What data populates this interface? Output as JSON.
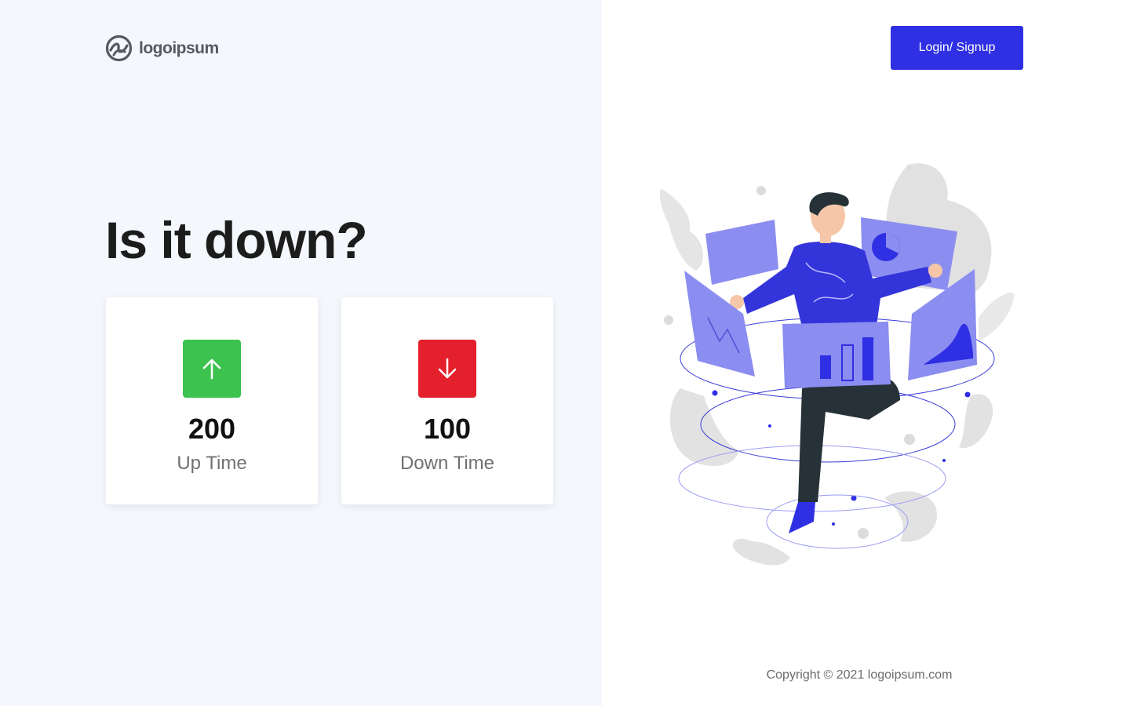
{
  "brand": {
    "logo_text": "logoipsum",
    "logo_icon": "logo-mark-icon"
  },
  "header": {
    "login_label": "Login/ Signup"
  },
  "main": {
    "headline": "Is it down?"
  },
  "stats": {
    "up": {
      "value": "200",
      "label": "Up Time",
      "icon": "arrow-up-icon",
      "color": "#3cc24f"
    },
    "down": {
      "value": "100",
      "label": "Down Time",
      "icon": "arrow-down-icon",
      "color": "#e3202b"
    }
  },
  "illustration": {
    "subject": "person-with-dashboard-panels"
  },
  "footer": {
    "copyright": "Copyright © 2021 logoipsum.com"
  },
  "colors": {
    "accent": "#2f2fe4",
    "panel": "#8b8df0",
    "left_bg": "#f4f7fb"
  }
}
